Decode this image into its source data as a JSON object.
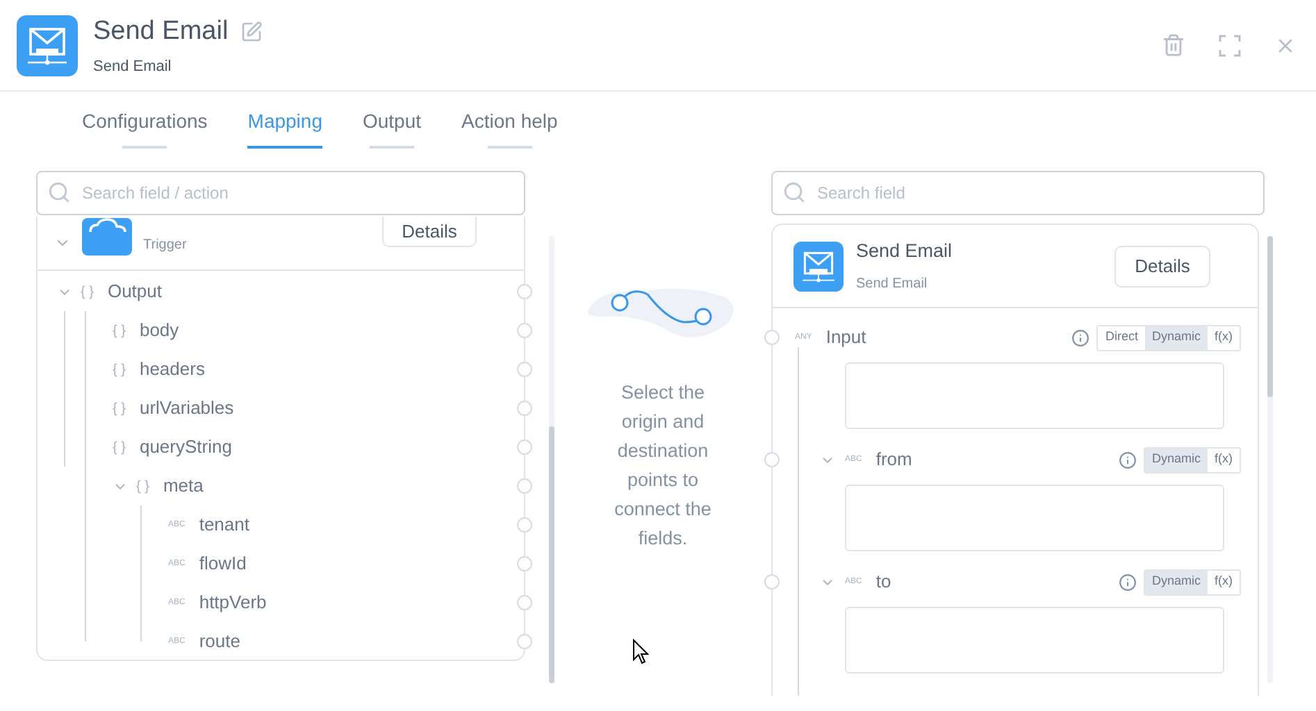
{
  "header": {
    "title": "Send Email",
    "subtitle": "Send Email"
  },
  "tabs": [
    {
      "label": "Configurations",
      "selected": false
    },
    {
      "label": "Mapping",
      "selected": true
    },
    {
      "label": "Output",
      "selected": false
    },
    {
      "label": "Action help",
      "selected": false
    }
  ],
  "source": {
    "search": {
      "placeholder": "Search field / action"
    },
    "trigger": {
      "subtitle": "Trigger",
      "button": "Details",
      "expanded": true
    },
    "tree": [
      {
        "type": "{ }",
        "label": "Output",
        "expanded": true,
        "children": [
          {
            "type": "{ }",
            "label": "body"
          },
          {
            "type": "{ }",
            "label": "headers"
          },
          {
            "type": "{ }",
            "label": "urlVariables"
          },
          {
            "type": "{ }",
            "label": "queryString"
          },
          {
            "type": "{ }",
            "label": "meta",
            "expanded": true,
            "children": [
              {
                "type": "ABC",
                "label": "tenant"
              },
              {
                "type": "ABC",
                "label": "flowId"
              },
              {
                "type": "ABC",
                "label": "httpVerb"
              },
              {
                "type": "ABC",
                "label": "route"
              }
            ]
          }
        ]
      }
    ]
  },
  "hint": "Select the origin and destination points to connect the fields.",
  "target": {
    "search": {
      "placeholder": "Search field"
    },
    "action": {
      "title": "Send Email",
      "subtitle": "Send Email",
      "button": "Details"
    },
    "fields": [
      {
        "type": "ANY",
        "label": "Input",
        "collapsible": false,
        "modes": [
          {
            "label": "Direct",
            "selected": false
          },
          {
            "label": "Dynamic",
            "selected": true
          },
          {
            "label": "f(x)",
            "selected": false
          }
        ]
      },
      {
        "type": "ABC",
        "label": "from",
        "collapsible": true,
        "modes": [
          {
            "label": "Dynamic",
            "selected": true
          },
          {
            "label": "f(x)",
            "selected": false
          }
        ]
      },
      {
        "type": "ABC",
        "label": "to",
        "collapsible": true,
        "modes": [
          {
            "label": "Dynamic",
            "selected": true
          },
          {
            "label": "f(x)",
            "selected": false
          }
        ]
      }
    ]
  }
}
